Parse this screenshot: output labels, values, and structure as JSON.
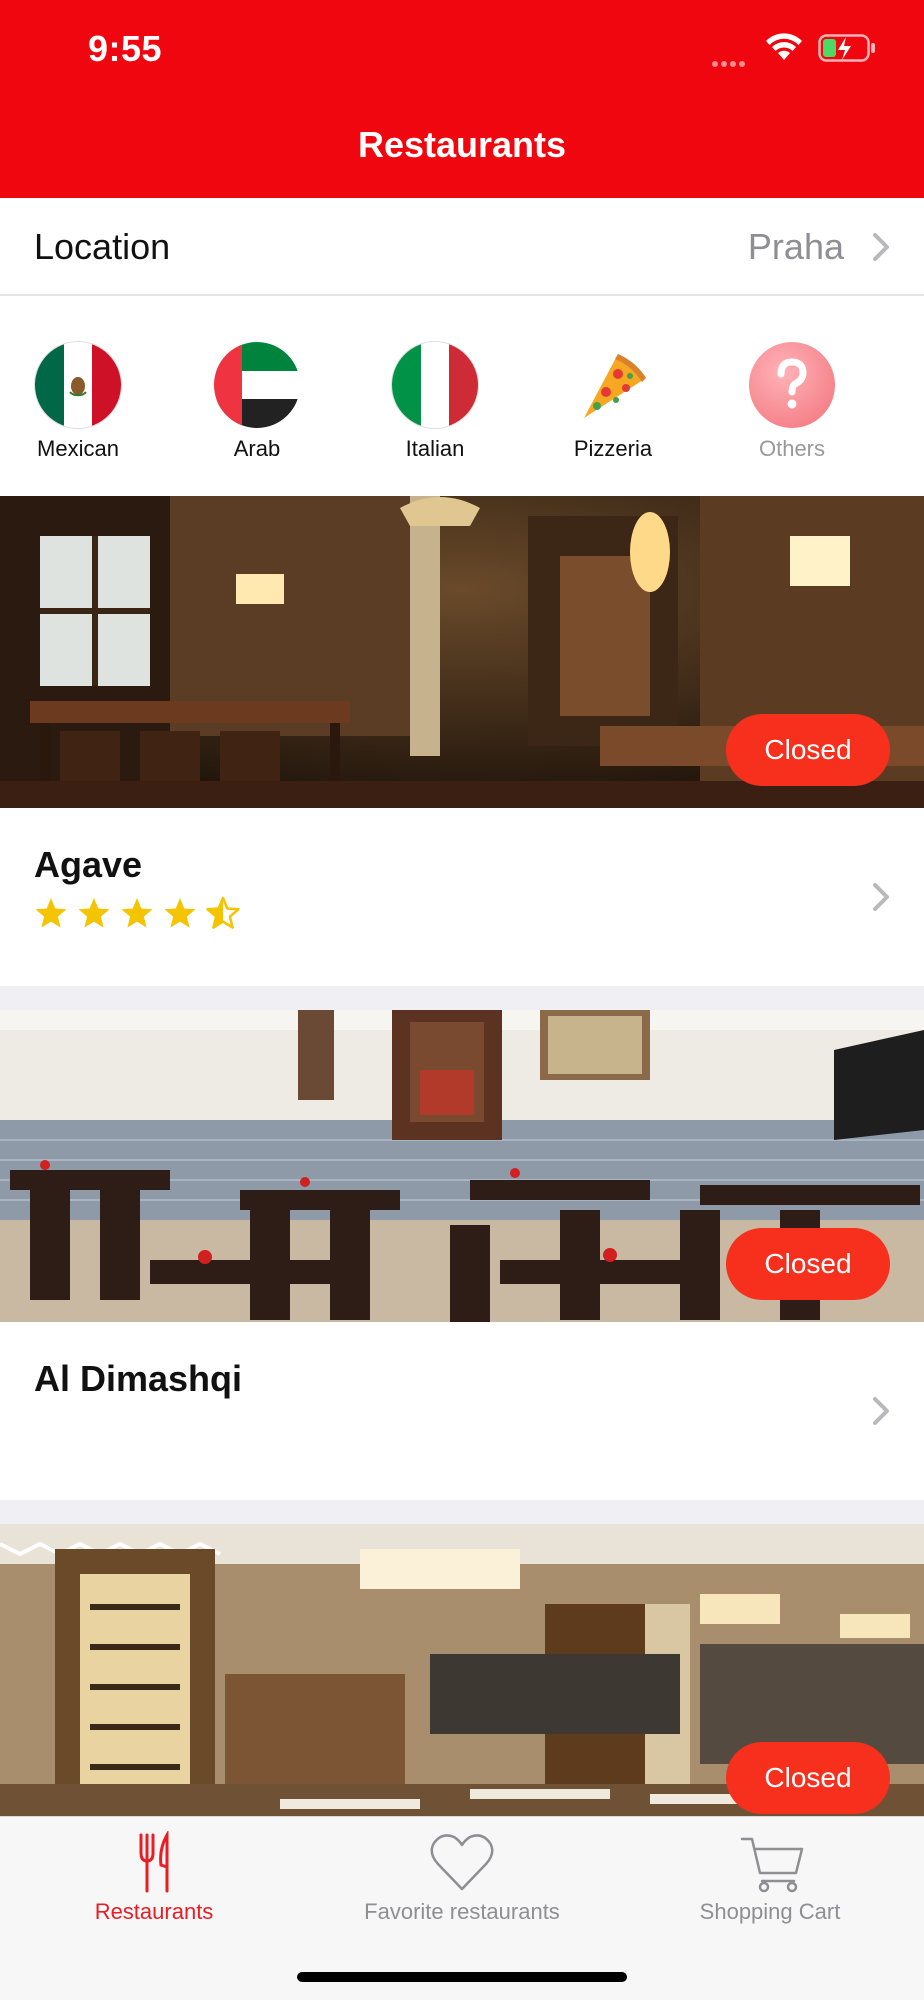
{
  "status_bar": {
    "time": "9:55"
  },
  "nav": {
    "title": "Restaurants"
  },
  "location": {
    "label": "Location",
    "value": "Praha"
  },
  "categories": [
    {
      "name": "Mexican",
      "icon": "mexico-flag-icon"
    },
    {
      "name": "Arab",
      "icon": "uae-flag-icon"
    },
    {
      "name": "Italian",
      "icon": "italy-flag-icon"
    },
    {
      "name": "Pizzeria",
      "icon": "pizza-slice-icon"
    },
    {
      "name": "Others",
      "icon": "question-mark-icon"
    }
  ],
  "restaurants": [
    {
      "name": "Agave",
      "status": "Closed",
      "rating": 4.5
    },
    {
      "name": "Al Dimashqi",
      "status": "Closed",
      "rating": null
    },
    {
      "name": "",
      "status": "Closed",
      "rating": null
    }
  ],
  "tabs": [
    {
      "label": "Restaurants",
      "icon": "fork-knife-icon",
      "active": true
    },
    {
      "label": "Favorite restaurants",
      "icon": "heart-icon",
      "active": false
    },
    {
      "label": "Shopping Cart",
      "icon": "cart-icon",
      "active": false
    }
  ],
  "colors": {
    "brand_red": "#f0060e",
    "badge_red": "#f7301d",
    "star_yellow": "#f5c400",
    "active_tab": "#ea1c24"
  }
}
